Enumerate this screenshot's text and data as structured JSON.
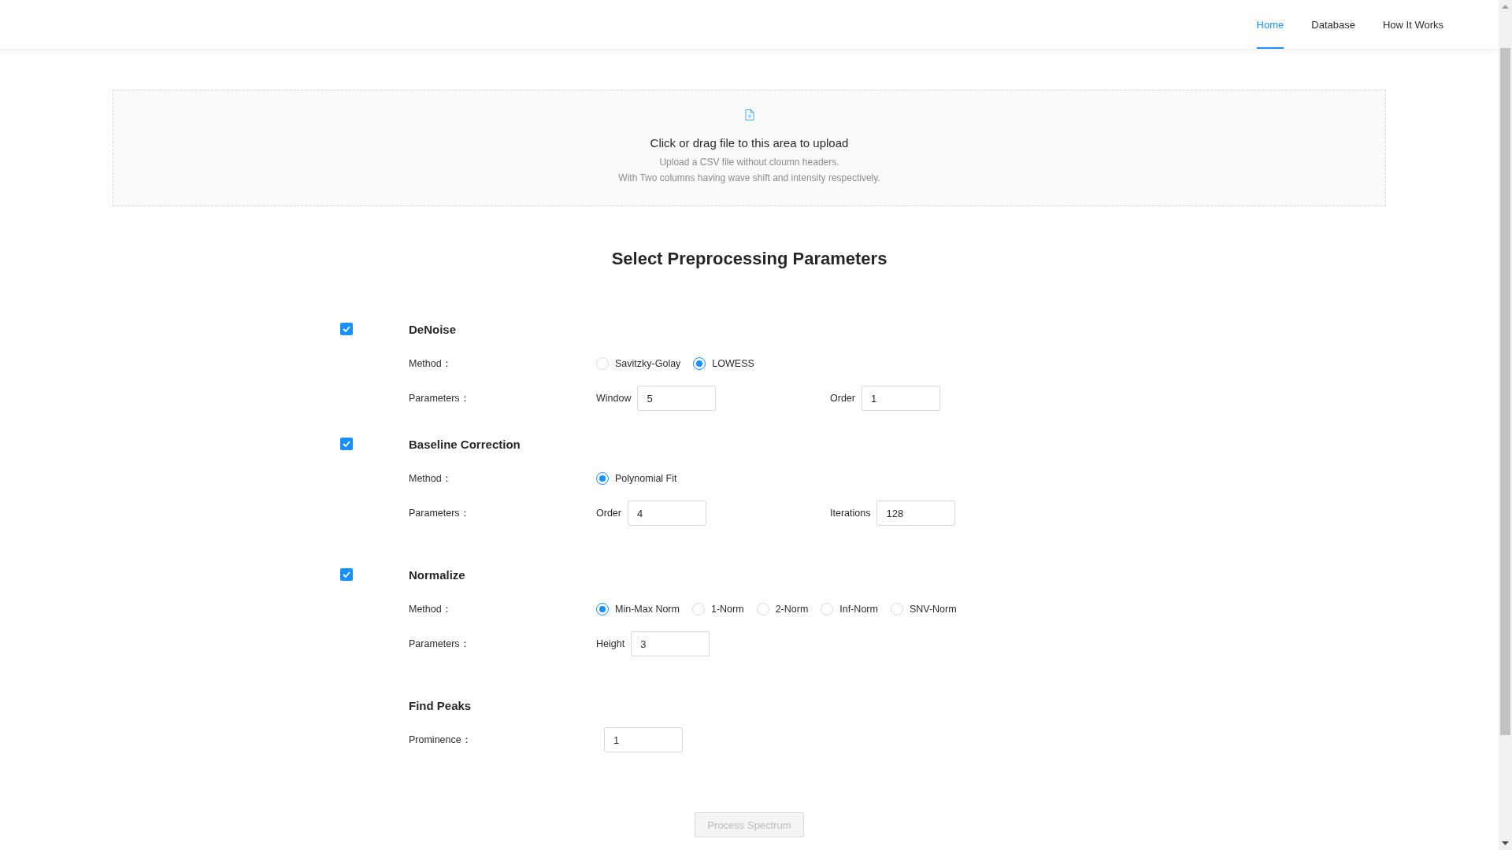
{
  "nav": [
    {
      "label": "Home",
      "selected": true
    },
    {
      "label": "Database",
      "selected": false
    },
    {
      "label": "How It Works",
      "selected": false
    }
  ],
  "upload": {
    "title": "Click or drag file to this area to upload",
    "hints": [
      "Upload a CSV file without cloumn headers.",
      "With Two columns having wave shift and intensity respectively."
    ]
  },
  "heading": "Select Preprocessing Parameters",
  "sections": [
    {
      "kind": "toggle",
      "title": "DeNoise",
      "checked": true,
      "rows": [
        {
          "kind": "radio",
          "label": "Method：",
          "options": [
            {
              "label": "Savitzky-Golay",
              "selected": false
            },
            {
              "label": "LOWESS",
              "selected": true
            }
          ]
        },
        {
          "kind": "params",
          "label": "Parameters：",
          "params": [
            {
              "label": "Window",
              "value": "5"
            },
            {
              "label": "Order",
              "value": "1"
            }
          ]
        }
      ]
    },
    {
      "kind": "toggle",
      "title": "Baseline Correction",
      "checked": true,
      "rows": [
        {
          "kind": "radio",
          "label": "Method：",
          "options": [
            {
              "label": "Polynomial Fit",
              "selected": true
            }
          ]
        },
        {
          "kind": "params",
          "label": "Parameters：",
          "params": [
            {
              "label": "Order",
              "value": "4"
            },
            {
              "label": "Iterations",
              "value": "128"
            }
          ]
        }
      ]
    },
    {
      "kind": "toggle",
      "title": "Normalize",
      "checked": true,
      "rows": [
        {
          "kind": "radio",
          "label": "Method：",
          "options": [
            {
              "label": "Min-Max Norm",
              "selected": true
            },
            {
              "label": "1-Norm",
              "selected": false
            },
            {
              "label": "2-Norm",
              "selected": false
            },
            {
              "label": "Inf-Norm",
              "selected": false
            },
            {
              "label": "SNV-Norm",
              "selected": false
            }
          ]
        },
        {
          "kind": "params",
          "label": "Parameters：",
          "params": [
            {
              "label": "Height",
              "value": "3"
            }
          ]
        }
      ]
    },
    {
      "kind": "plain",
      "title": "Find Peaks",
      "rows": [
        {
          "kind": "field",
          "label": "Prominence：",
          "value": "1"
        }
      ]
    }
  ],
  "process_button": {
    "label": "Process Spectrum",
    "disabled": true
  }
}
